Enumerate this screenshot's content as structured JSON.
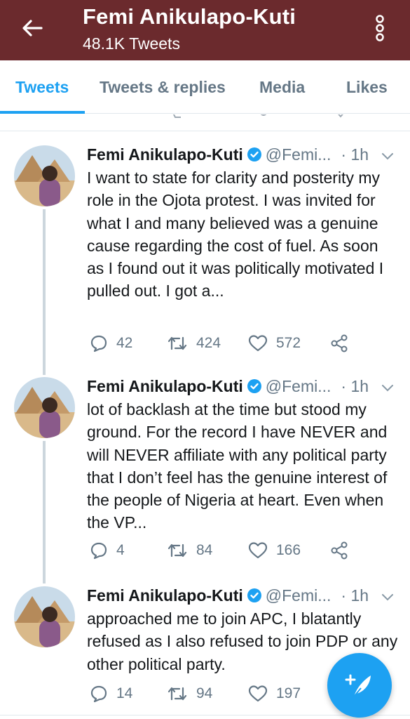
{
  "header": {
    "title": "Femi Anikulapo-Kuti",
    "subtitle": "48.1K Tweets",
    "back_icon": "arrow-left-icon",
    "more_icon": "more-vertical-icon",
    "background_color": "#6b2a2d"
  },
  "tabs": [
    {
      "label": "Tweets",
      "active": true
    },
    {
      "label": "Tweets & replies",
      "active": false
    },
    {
      "label": "Media",
      "active": false
    },
    {
      "label": "Likes",
      "active": false
    }
  ],
  "tweets": [
    {
      "name": "Femi Anikulapo-Kuti",
      "handle": "@Femi...",
      "time": "· 1h",
      "text": "I want to state for clarity and posterity my role in the Ojota protest.  I was invited for what I and many believed was a genuine cause regarding the cost of fuel.  As soon as I found out it was politically motivated  I pulled out. I got a...",
      "replies": "42",
      "retweets": "424",
      "likes": "572"
    },
    {
      "name": "Femi Anikulapo-Kuti",
      "handle": "@Femi...",
      "time": "· 1h",
      "text": "lot of backlash at the time but stood my ground. For the record I have NEVER and will NEVER affiliate with any political party that I don’t feel has the genuine interest of the people of Nigeria at heart. Even when the VP...",
      "replies": "4",
      "retweets": "84",
      "likes": "166"
    },
    {
      "name": "Femi Anikulapo-Kuti",
      "handle": "@Femi...",
      "time": "· 1h",
      "text": "approached me to join APC, I blatantly refused as I also refused to join PDP or any other political party.",
      "replies": "14",
      "retweets": "94",
      "likes": "197"
    }
  ],
  "colors": {
    "accent": "#1da1f2",
    "secondary_text": "#657786",
    "divider": "#e1e8ed"
  },
  "fab_icon": "compose-tweet-icon"
}
